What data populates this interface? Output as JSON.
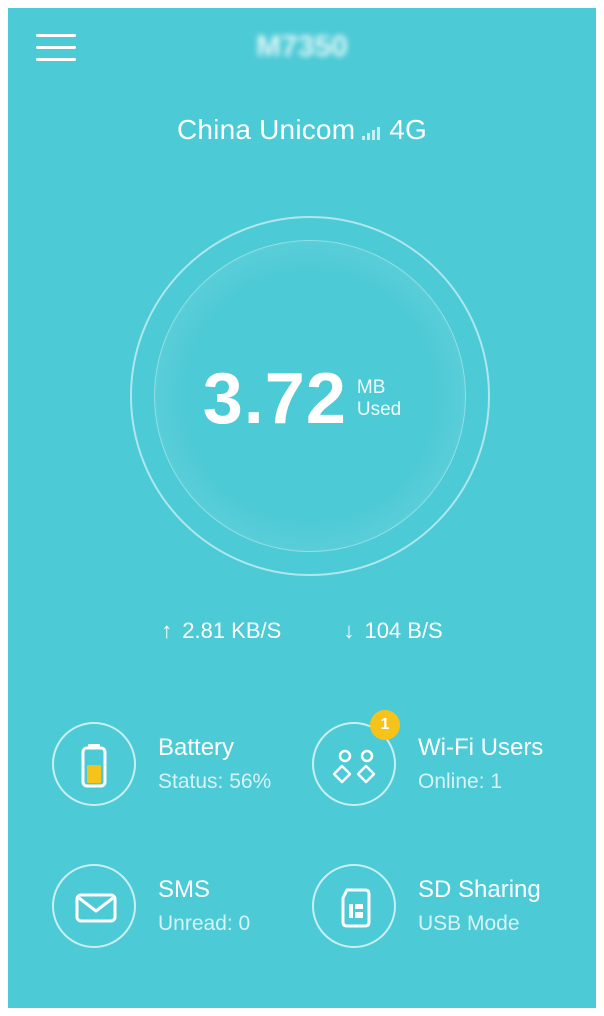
{
  "header": {
    "device_name": "M7350",
    "menu_icon": "hamburger-menu-icon"
  },
  "network": {
    "carrier": "China Unicom",
    "signal_icon": "signal-bars-icon",
    "type": "4G"
  },
  "usage": {
    "value": "3.72",
    "unit": "MB",
    "label": "Used"
  },
  "speeds": {
    "upload": "2.81 KB/S",
    "download": "104 B/S",
    "upload_icon": "arrow-up-icon",
    "download_icon": "arrow-down-icon"
  },
  "tiles": {
    "battery": {
      "title": "Battery",
      "subtitle": "Status: 56%",
      "level": 0.56,
      "icon": "battery-icon"
    },
    "wifi_users": {
      "title": "Wi-Fi Users",
      "subtitle": "Online: 1",
      "badge": "1",
      "icon": "users-icon"
    },
    "sms": {
      "title": "SMS",
      "subtitle": "Unread: 0",
      "icon": "envelope-icon"
    },
    "sd_sharing": {
      "title": "SD Sharing",
      "subtitle": "USB Mode",
      "icon": "sd-card-icon"
    }
  },
  "colors": {
    "background": "#4ccad6",
    "battery_fill": "#f6c31a",
    "badge": "#f6c31a"
  }
}
